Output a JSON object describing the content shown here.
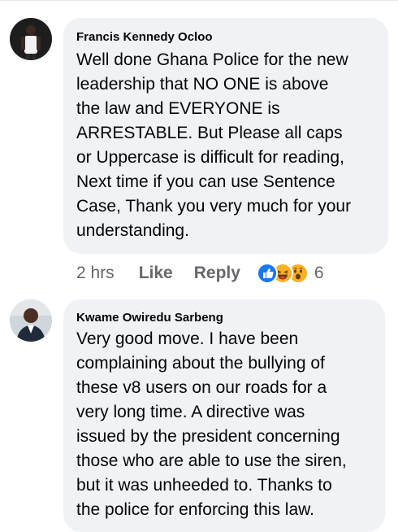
{
  "comments": [
    {
      "author": "Francis Kennedy Ocloo",
      "text": "Well done Ghana Police for the new\nleadership that NO ONE is above\nthe law and EVERYONE is\nARRESTABLE. But Please all caps\nor Uppercase is difficult for reading,\nNext time if you can use Sentence\nCase, Thank you very much for your\nunderstanding.",
      "time": "2 hrs",
      "like_label": "Like",
      "reply_label": "Reply",
      "reaction_icons": [
        "like-icon",
        "haha-icon",
        "wow-icon"
      ],
      "reaction_count": "6"
    },
    {
      "author": "Kwame Owiredu Sarbeng",
      "text": "Very good move. I have been\ncomplaining about the bullying of\nthese v8 users on our roads for a\nvery long time. A directive was\nissued by the president concerning\nthose who are able to use the siren,\nbut it was unheeded to. Thanks to\nthe police for enforcing this law."
    }
  ],
  "colors": {
    "bubble": "#f0f2f5",
    "text": "#050505",
    "secondary": "#65676b",
    "like_blue": "#1877f2",
    "haha_yellow": "#f7b125"
  }
}
